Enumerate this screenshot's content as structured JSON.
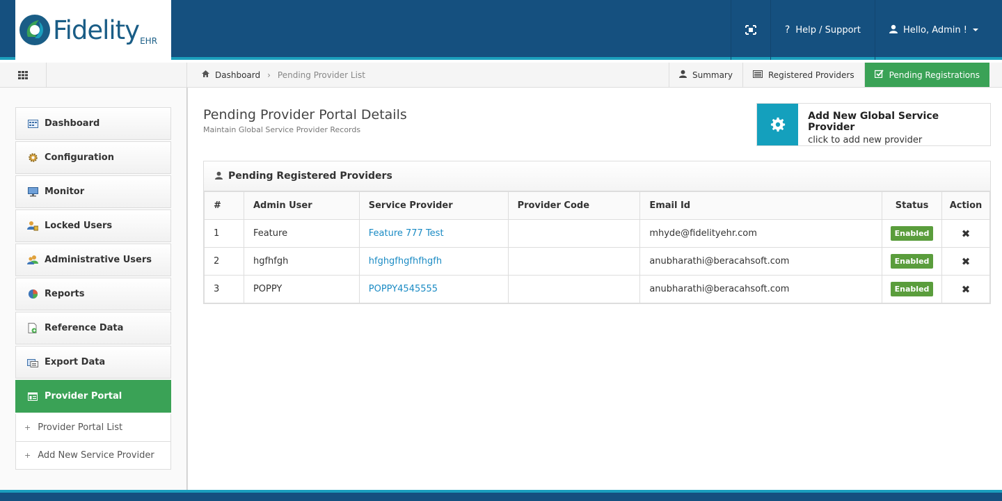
{
  "header": {
    "logo_text": "Fidelity",
    "logo_suffix": "EHR",
    "fullscreen_icon": "fullscreen-icon",
    "help_label": "Help / Support",
    "user_label": "Hello, Admin !"
  },
  "subbar": {
    "breadcrumb": {
      "home": "Dashboard",
      "current": "Pending Provider List"
    },
    "tabs": [
      {
        "label": "Summary",
        "icon": "user-icon"
      },
      {
        "label": "Registered Providers",
        "icon": "list-icon"
      },
      {
        "label": "Pending Registrations",
        "icon": "checkbox-icon"
      }
    ]
  },
  "sidebar": {
    "items": [
      {
        "label": "Dashboard"
      },
      {
        "label": "Configuration"
      },
      {
        "label": "Monitor"
      },
      {
        "label": "Locked Users"
      },
      {
        "label": "Administrative Users"
      },
      {
        "label": "Reports"
      },
      {
        "label": "Reference Data"
      },
      {
        "label": "Export Data"
      },
      {
        "label": "Provider Portal"
      }
    ],
    "subitems": [
      {
        "label": "Provider Portal List"
      },
      {
        "label": "Add New Service Provider"
      }
    ]
  },
  "main": {
    "title": "Pending Provider Portal Details",
    "subtitle": "Maintain Global Service Provider Records",
    "add_card": {
      "title": "Add New Global Service Provider",
      "subtitle": "click to add new provider"
    },
    "panel_title": "Pending Registered Providers",
    "columns": [
      "#",
      "Admin User",
      "Service Provider",
      "Provider Code",
      "Email Id",
      "Status",
      "Action"
    ],
    "rows": [
      {
        "num": "1",
        "admin": "Feature",
        "provider": "Feature 777 Test",
        "code": "",
        "email": "mhyde@fidelityehr.com",
        "status": "Enabled"
      },
      {
        "num": "2",
        "admin": "hgfhfgh",
        "provider": "hfghgfhgfhfhgfh",
        "code": "",
        "email": "anubharathi@beracahsoft.com",
        "status": "Enabled"
      },
      {
        "num": "3",
        "admin": "POPPY",
        "provider": "POPPY4545555",
        "code": "",
        "email": "anubharathi@beracahsoft.com",
        "status": "Enabled"
      }
    ],
    "action_glyph": "✖"
  },
  "colors": {
    "header_bg": "#15507f",
    "accent_teal": "#1b9fbd",
    "active_green": "#3aa256",
    "badge_green": "#5a9d3c",
    "link_blue": "#1b8bc4"
  }
}
